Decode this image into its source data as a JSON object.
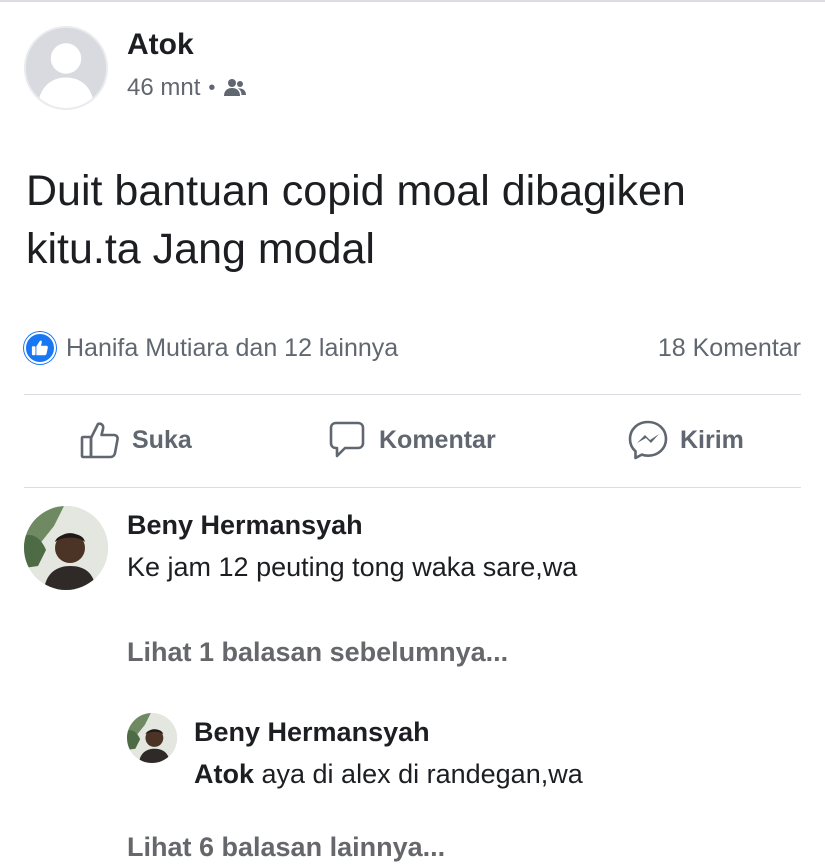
{
  "post": {
    "author": "Atok",
    "time": "46 mnt",
    "separator": "•",
    "privacy_icon": "friends-icon",
    "text_line1": "Duit bantuan copid moal dibagiken",
    "text_line2": "kitu.ta Jang modal"
  },
  "reactions": {
    "summary": "Hanifa Mutiara dan 12 lainnya",
    "comments_count": "18 Komentar",
    "reaction_icon": "like-icon",
    "accent": "#1877f2"
  },
  "actions": {
    "like": "Suka",
    "comment": "Komentar",
    "send": "Kirim"
  },
  "comments": [
    {
      "name": "Beny Hermansyah",
      "text": "Ke jam 12 peuting tong waka sare,wa"
    }
  ],
  "view_previous": "Lihat 1 balasan sebelumnya...",
  "reply": {
    "name": "Beny Hermansyah",
    "mention": "Atok",
    "text": " aya di alex di randegan,wa"
  },
  "view_more": "Lihat 6 balasan lainnya..."
}
